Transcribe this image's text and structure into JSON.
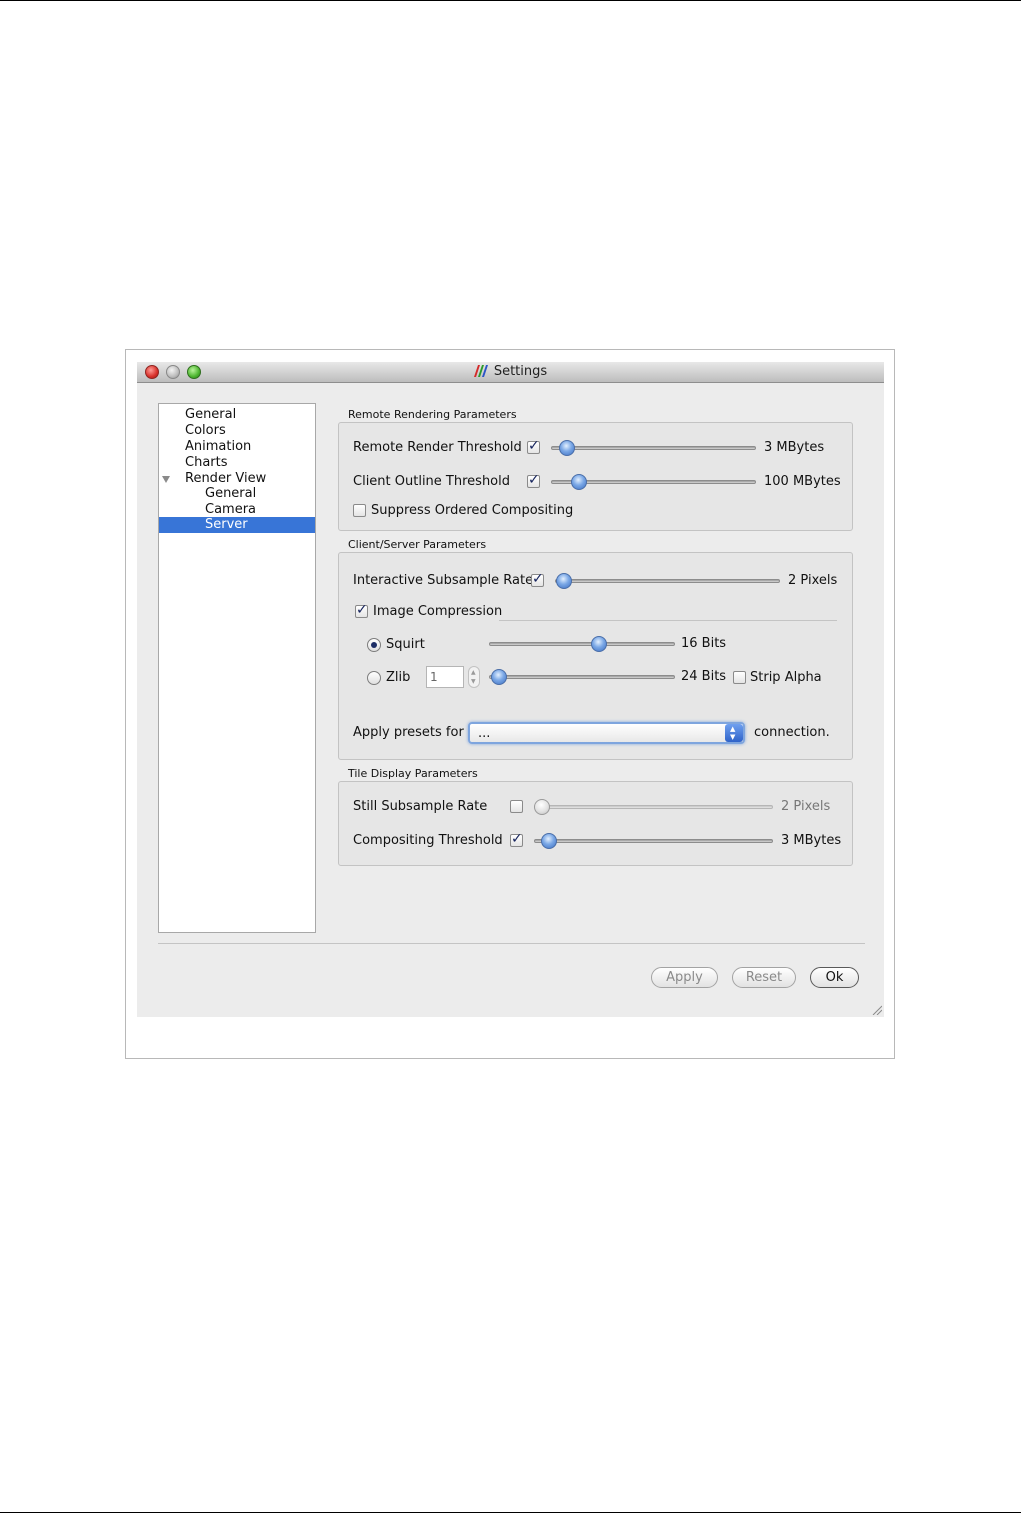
{
  "window": {
    "title": "Settings",
    "traffic_lights": [
      "close",
      "minimize",
      "zoom"
    ]
  },
  "tree": {
    "items": [
      {
        "label": "General",
        "level": 0
      },
      {
        "label": "Colors",
        "level": 0
      },
      {
        "label": "Animation",
        "level": 0
      },
      {
        "label": "Charts",
        "level": 0
      },
      {
        "label": "Render View",
        "level": 0,
        "expanded": true
      },
      {
        "label": "General",
        "level": 1
      },
      {
        "label": "Camera",
        "level": 1
      },
      {
        "label": "Server",
        "level": 1,
        "selected": true
      }
    ]
  },
  "remote_rendering": {
    "title": "Remote Rendering Parameters",
    "remote_render_threshold": {
      "label": "Remote Render Threshold",
      "checked": true,
      "value": "3 MBytes"
    },
    "client_outline_threshold": {
      "label": "Client Outline Threshold",
      "checked": true,
      "value": "100 MBytes"
    },
    "suppress_ordered_compositing": {
      "label": "Suppress Ordered Compositing",
      "checked": false
    }
  },
  "client_server": {
    "title": "Client/Server Parameters",
    "interactive_subsample_rate": {
      "label": "Interactive Subsample Rate",
      "checked": true,
      "value": "2 Pixels"
    },
    "image_compression": {
      "label": "Image Compression",
      "checked": true
    },
    "squirt": {
      "label": "Squirt",
      "selected": true,
      "value": "16 Bits"
    },
    "zlib": {
      "label": "Zlib",
      "selected": false,
      "spin_value": "1",
      "value": "24 Bits"
    },
    "strip_alpha": {
      "label": "Strip Alpha",
      "checked": false
    },
    "presets": {
      "prefix": "Apply presets for",
      "selected": "...",
      "suffix": "connection."
    }
  },
  "tile_display": {
    "title": "Tile Display Parameters",
    "still_subsample_rate": {
      "label": "Still Subsample Rate",
      "checked": false,
      "value": "2 Pixels"
    },
    "compositing_threshold": {
      "label": "Compositing Threshold",
      "checked": true,
      "value": "3 MBytes"
    }
  },
  "buttons": {
    "apply": "Apply",
    "reset": "Reset",
    "ok": "Ok"
  },
  "colors": {
    "selection": "#3875d7",
    "accent_blue": "#3c6fc2"
  }
}
